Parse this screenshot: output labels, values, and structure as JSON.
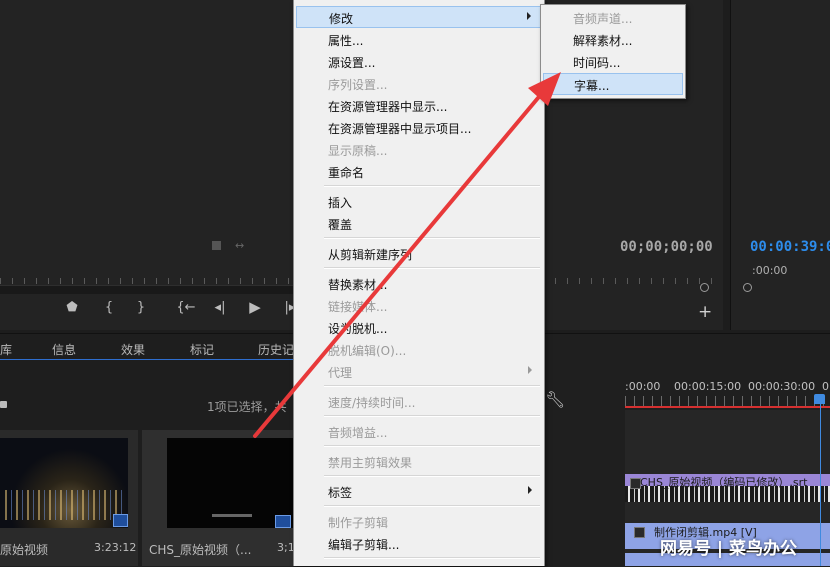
{
  "source_monitor": {
    "transport_icons": [
      "marker-icon",
      "in-point-icon",
      "out-point-icon",
      "go-to-in-icon",
      "step-back-icon",
      "play-icon",
      "step-forward-icon"
    ]
  },
  "program_monitor": {
    "timecode_left": "00;00;00;00",
    "timecode_right": "00:00:39:00",
    "timecode_small": ":00:00"
  },
  "project_panel": {
    "tabs": [
      "库",
      "信息",
      "效果",
      "标记",
      "历史记"
    ],
    "selection_status": "1项已选择，共",
    "items": [
      {
        "name": "原始视频",
        "duration": "3:23:12"
      },
      {
        "name": "CHS_原始视频（...",
        "duration": "3;1"
      }
    ]
  },
  "timeline": {
    "ruler_labels": [
      ":00:00",
      "00:00:15:00",
      "00:00:30:00",
      "0"
    ],
    "subtitle_clip_label": "CHS_原始视频（编码已修改）.srt",
    "video_clip_label": "制作闭剪辑.mp4 [V]",
    "watermark": "网易号 | 菜鸟办公"
  },
  "context_menu": {
    "items": [
      {
        "label": "修改",
        "enabled": true,
        "submenu": true,
        "highlighted": true
      },
      {
        "label": "属性...",
        "enabled": true
      },
      {
        "label": "源设置...",
        "enabled": true
      },
      {
        "label": "序列设置...",
        "enabled": false
      },
      {
        "label": "在资源管理器中显示...",
        "enabled": true
      },
      {
        "label": "在资源管理器中显示项目...",
        "enabled": true
      },
      {
        "label": "显示原稿...",
        "enabled": false
      },
      {
        "label": "重命名",
        "enabled": true
      },
      {
        "label": "插入",
        "enabled": true
      },
      {
        "label": "覆盖",
        "enabled": true
      },
      {
        "label": "从剪辑新建序列",
        "enabled": true
      },
      {
        "label": "替换素材...",
        "enabled": true
      },
      {
        "label": "链接媒体...",
        "enabled": false
      },
      {
        "label": "设为脱机...",
        "enabled": true
      },
      {
        "label": "脱机编辑(O)...",
        "enabled": false
      },
      {
        "label": "代理",
        "enabled": false,
        "submenu": true
      },
      {
        "label": "速度/持续时间...",
        "enabled": false
      },
      {
        "label": "音频增益...",
        "enabled": false
      },
      {
        "label": "禁用主剪辑效果",
        "enabled": false
      },
      {
        "label": "标签",
        "enabled": true,
        "submenu": true
      },
      {
        "label": "制作子剪辑",
        "enabled": false
      },
      {
        "label": "编辑子剪辑...",
        "enabled": true
      }
    ]
  },
  "submenu": {
    "items": [
      {
        "label": "音频声道...",
        "enabled": false
      },
      {
        "label": "解释素材...",
        "enabled": true
      },
      {
        "label": "时间码...",
        "enabled": true
      },
      {
        "label": "字幕...",
        "enabled": true,
        "highlighted": true
      }
    ]
  },
  "annotation": {
    "arrow_color": "#e8393a"
  }
}
